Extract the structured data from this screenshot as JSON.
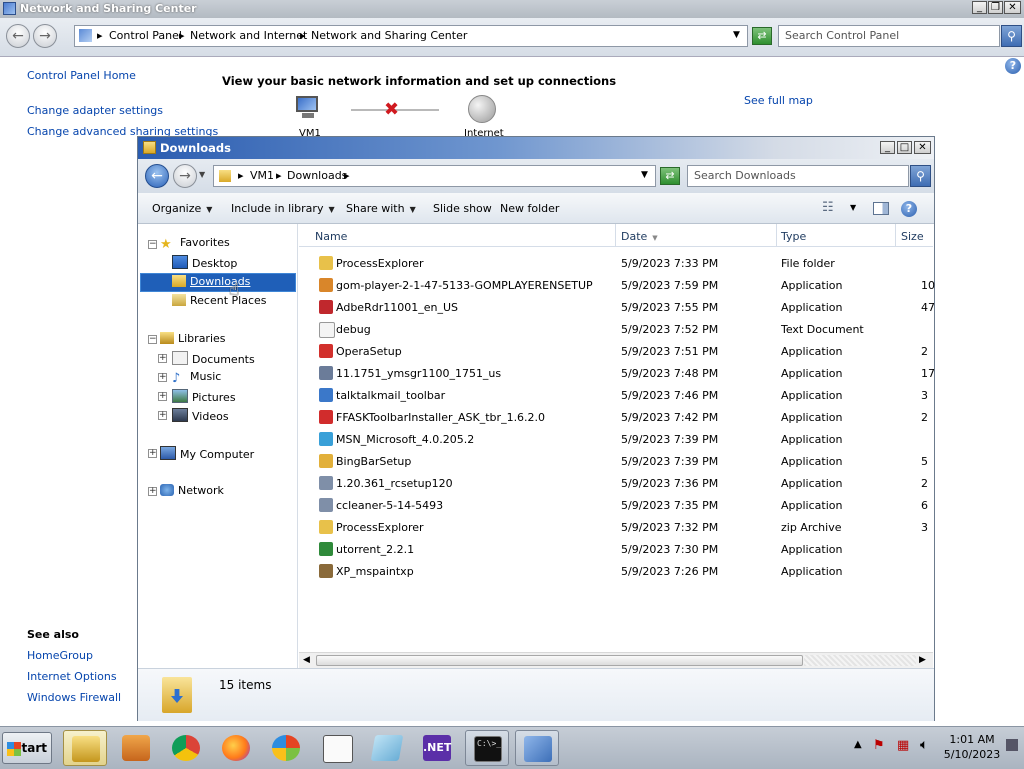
{
  "background_window": {
    "title": "Network and Sharing Center",
    "breadcrumbs": [
      "Control Panel",
      "Network and Internet",
      "Network and Sharing Center"
    ],
    "search_placeholder": "Search Control Panel",
    "sidebar_links": [
      "Control Panel Home",
      "Change adapter settings",
      "Change advanced sharing settings"
    ],
    "heading": "View your basic network information and set up connections",
    "see_full_map": "See full map",
    "map_nodes": [
      "VM1",
      "Internet"
    ],
    "see_also_title": "See also",
    "see_also_links": [
      "HomeGroup",
      "Internet Options",
      "Windows Firewall"
    ]
  },
  "explorer": {
    "title": "Downloads",
    "breadcrumbs": [
      "VM1",
      "Downloads"
    ],
    "search_placeholder": "Search Downloads",
    "toolbar": {
      "organize": "Organize",
      "include_in_library": "Include in library",
      "share_with": "Share with",
      "slide_show": "Slide show",
      "new_folder": "New folder"
    },
    "nav": {
      "favorites": "Favorites",
      "favorites_items": [
        "Desktop",
        "Downloads",
        "Recent Places"
      ],
      "libraries": "Libraries",
      "library_items": [
        "Documents",
        "Music",
        "Pictures",
        "Videos"
      ],
      "my_computer": "My Computer",
      "network": "Network",
      "selected": "Downloads"
    },
    "columns": [
      "Name",
      "Date",
      "Type",
      "Size"
    ],
    "files": [
      {
        "name": "ProcessExplorer",
        "date": "5/9/2023 7:33 PM",
        "type": "File folder",
        "size": "",
        "icon_color": "#e8c14a"
      },
      {
        "name": "gom-player-2-1-47-5133-GOMPLAYERENSETUP",
        "date": "5/9/2023 7:59 PM",
        "type": "Application",
        "size": "10",
        "icon_color": "#d9862a"
      },
      {
        "name": "AdbeRdr11001_en_US",
        "date": "5/9/2023 7:55 PM",
        "type": "Application",
        "size": "47",
        "icon_color": "#c0282d"
      },
      {
        "name": "debug",
        "date": "5/9/2023 7:52 PM",
        "type": "Text Document",
        "size": "",
        "icon_color": "#f4f4f4"
      },
      {
        "name": "OperaSetup",
        "date": "5/9/2023 7:51 PM",
        "type": "Application",
        "size": "2",
        "icon_color": "#d2302c"
      },
      {
        "name": "11.1751_ymsgr1100_1751_us",
        "date": "5/9/2023 7:48 PM",
        "type": "Application",
        "size": "17",
        "icon_color": "#6b7c99"
      },
      {
        "name": "talktalkmail_toolbar",
        "date": "5/9/2023 7:46 PM",
        "type": "Application",
        "size": "3",
        "icon_color": "#3b78c9"
      },
      {
        "name": "FFASKToolbarInstaller_ASK_tbr_1.6.2.0",
        "date": "5/9/2023 7:42 PM",
        "type": "Application",
        "size": "2",
        "icon_color": "#d12c2c"
      },
      {
        "name": "MSN_Microsoft_4.0.205.2",
        "date": "5/9/2023 7:39 PM",
        "type": "Application",
        "size": "",
        "icon_color": "#39a0d8"
      },
      {
        "name": "BingBarSetup",
        "date": "5/9/2023 7:39 PM",
        "type": "Application",
        "size": "5",
        "icon_color": "#e2b03a"
      },
      {
        "name": "1.20.361_rcsetup120",
        "date": "5/9/2023 7:36 PM",
        "type": "Application",
        "size": "2",
        "icon_color": "#7f8fa8"
      },
      {
        "name": "ccleaner-5-14-5493",
        "date": "5/9/2023 7:35 PM",
        "type": "Application",
        "size": "6",
        "icon_color": "#7f8fa8"
      },
      {
        "name": "ProcessExplorer",
        "date": "5/9/2023 7:32 PM",
        "type": "zip Archive",
        "size": "3",
        "icon_color": "#e8c14a"
      },
      {
        "name": "utorrent_2.2.1",
        "date": "5/9/2023 7:30 PM",
        "type": "Application",
        "size": "",
        "icon_color": "#2f8a3a"
      },
      {
        "name": "XP_mspaintxp",
        "date": "5/9/2023 7:26 PM",
        "type": "Application",
        "size": "",
        "icon_color": "#8a6a3a"
      }
    ],
    "item_count": "15 items"
  },
  "taskbar": {
    "start_label": "Start",
    "apps": [
      "explorer-icon",
      "media-player-icon",
      "chrome-icon",
      "firefox-icon",
      "windows-xp-icon",
      "notepad-icon",
      "paint-icon",
      ".NET",
      "cmd-icon",
      "control-panel-icon"
    ],
    "net_label": ".NET",
    "cmd_label": "C:\\>_",
    "time": "1:01 AM",
    "date": "5/10/2023"
  }
}
